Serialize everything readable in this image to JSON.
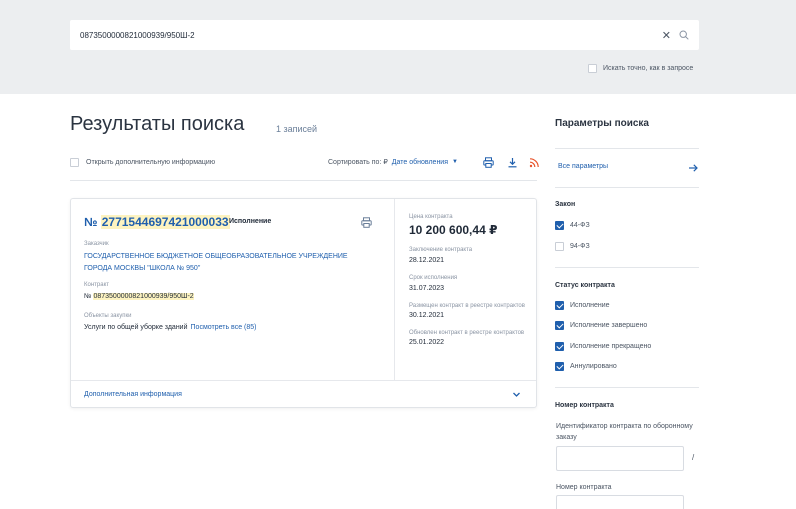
{
  "search": {
    "value": "0873500000821000939/950Ш-2",
    "clear_glyph": "✕",
    "exact_label": "Искать точно, как в запросе"
  },
  "results": {
    "title": "Результаты поиска",
    "count": "1 записей",
    "open_info_label": "Открыть дополнительную информацию",
    "sort_label": "Сортировать по: ₽",
    "sort_value": "Дате обновления"
  },
  "card": {
    "number_prefix": "№",
    "number": "2771544697421000033",
    "status": "Исполнение",
    "customer_label": "Заказчик",
    "customer_name": "ГОСУДАРСТВЕННОЕ БЮДЖЕТНОЕ ОБЩЕОБРАЗОВАТЕЛЬНОЕ УЧРЕЖДЕНИЕ ГОРОДА МОСКВЫ \"ШКОЛА № 950\"",
    "contract_label": "Контракт",
    "contract_prefix": "№",
    "contract_value": "0873500000821000939/950Ш-2",
    "objects_label": "Объекты закупки",
    "objects_value": "Услуги по общей уборке зданий",
    "objects_link": "Посмотреть все (85)",
    "price_label": "Цена контракта",
    "price_value": "10 200 600,44 ₽",
    "concluded_label": "Заключение контракта",
    "concluded_value": "28.12.2021",
    "term_label": "Срок исполнения",
    "term_value": "31.07.2023",
    "placed_label": "Размещен контракт в реестре контрактов",
    "placed_value": "30.12.2021",
    "updated_label": "Обновлен контракт в реестре контрактов",
    "updated_value": "25.01.2022",
    "more_info": "Дополнительная информация"
  },
  "sidebar": {
    "title": "Параметры поиска",
    "all_params": "Все параметры",
    "law_title": "Закон",
    "laws": [
      {
        "label": "44-ФЗ",
        "checked": true
      },
      {
        "label": "94-ФЗ",
        "checked": false
      }
    ],
    "status_title": "Статус контракта",
    "statuses": [
      {
        "label": "Исполнение",
        "checked": true
      },
      {
        "label": "Исполнение завершено",
        "checked": true
      },
      {
        "label": "Исполнение прекращено",
        "checked": true
      },
      {
        "label": "Аннулировано",
        "checked": true
      }
    ],
    "number_title": "Номер контракта",
    "defense_id_label": "Идентификатор контракта по оборонному заказу",
    "slash": "/",
    "contract_number_label": "Номер контракта"
  },
  "colors": {
    "accent": "#1f5fad",
    "highlight": "#fdf3c0",
    "band": "#eceef0"
  }
}
